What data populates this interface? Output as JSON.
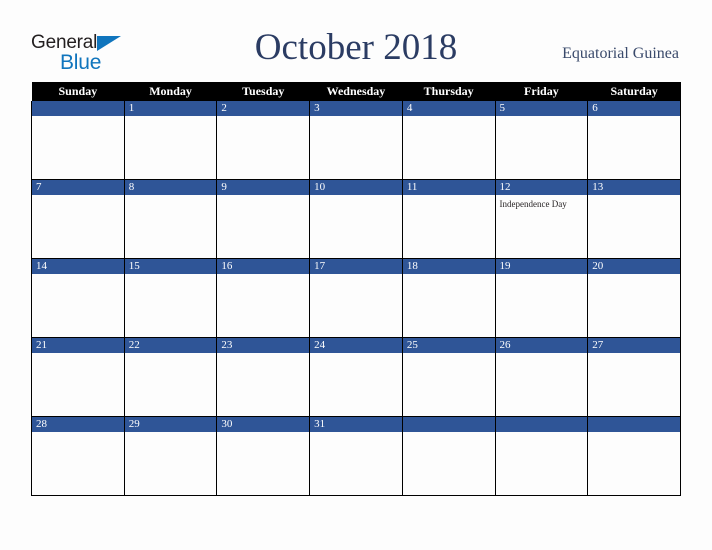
{
  "logo": {
    "word_one": "General",
    "word_two": "Blue",
    "triangle_icon": "triangle-icon",
    "brand_blue": "#1075bd",
    "brand_dark": "#231f20"
  },
  "header": {
    "title": "October 2018",
    "country": "Equatorial Guinea",
    "title_color": "#2b3c63",
    "country_color": "#3a4a6b"
  },
  "calendar": {
    "header_bg": "#000000",
    "header_fg": "#ffffff",
    "daynum_bg": "#2f5597",
    "daynum_fg": "#ffffff",
    "cell_bg": "#fdfdfd",
    "grid_color": "#000000",
    "weekdays": [
      "Sunday",
      "Monday",
      "Tuesday",
      "Wednesday",
      "Thursday",
      "Friday",
      "Saturday"
    ],
    "weeks": [
      [
        {
          "day": "",
          "event": ""
        },
        {
          "day": "1",
          "event": ""
        },
        {
          "day": "2",
          "event": ""
        },
        {
          "day": "3",
          "event": ""
        },
        {
          "day": "4",
          "event": ""
        },
        {
          "day": "5",
          "event": ""
        },
        {
          "day": "6",
          "event": ""
        }
      ],
      [
        {
          "day": "7",
          "event": ""
        },
        {
          "day": "8",
          "event": ""
        },
        {
          "day": "9",
          "event": ""
        },
        {
          "day": "10",
          "event": ""
        },
        {
          "day": "11",
          "event": ""
        },
        {
          "day": "12",
          "event": "Independence Day"
        },
        {
          "day": "13",
          "event": ""
        }
      ],
      [
        {
          "day": "14",
          "event": ""
        },
        {
          "day": "15",
          "event": ""
        },
        {
          "day": "16",
          "event": ""
        },
        {
          "day": "17",
          "event": ""
        },
        {
          "day": "18",
          "event": ""
        },
        {
          "day": "19",
          "event": ""
        },
        {
          "day": "20",
          "event": ""
        }
      ],
      [
        {
          "day": "21",
          "event": ""
        },
        {
          "day": "22",
          "event": ""
        },
        {
          "day": "23",
          "event": ""
        },
        {
          "day": "24",
          "event": ""
        },
        {
          "day": "25",
          "event": ""
        },
        {
          "day": "26",
          "event": ""
        },
        {
          "day": "27",
          "event": ""
        }
      ],
      [
        {
          "day": "28",
          "event": ""
        },
        {
          "day": "29",
          "event": ""
        },
        {
          "day": "30",
          "event": ""
        },
        {
          "day": "31",
          "event": ""
        },
        {
          "day": "",
          "event": ""
        },
        {
          "day": "",
          "event": ""
        },
        {
          "day": "",
          "event": ""
        }
      ]
    ]
  }
}
